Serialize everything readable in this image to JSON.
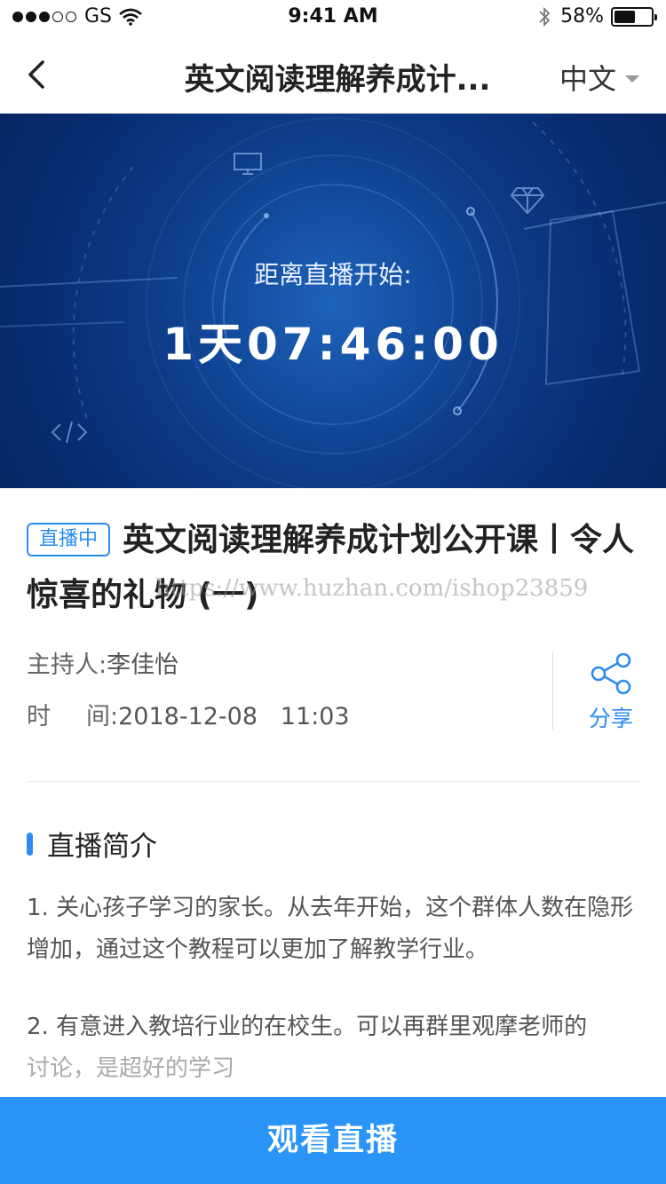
{
  "status_bar": {
    "carrier": "GS",
    "time": "9:41 AM",
    "battery_text": "58%",
    "battery_level": 0.58
  },
  "nav": {
    "title": "英文阅读理解养成计...",
    "language": "中文"
  },
  "hero": {
    "countdown_label": "距离直播开始:",
    "countdown_value": "1天07:46:00"
  },
  "course": {
    "badge": "直播中",
    "title": "英文阅读理解养成计划公开课丨令人惊喜的礼物 (一)",
    "watermark": "https://www.huzhan.com/ishop23859"
  },
  "meta": {
    "host_label": "主持人:",
    "host_name": "李佳怡",
    "time_label_1": "时",
    "time_label_2": "间:",
    "time_value": "2018-12-08   11:03"
  },
  "share": {
    "label": "分享"
  },
  "intro": {
    "heading": "直播简介",
    "paragraph_1": "1. 关心孩子学习的家长。从去年开始，这个群体人数在隐形增加，通过这个教程可以更加了解教学行业。",
    "paragraph_2_line_1": "2. 有意进入教培行业的在校生。可以再群里观摩老师的",
    "paragraph_2_line_2": "讨论，是超好的学习"
  },
  "cta": {
    "label": "观看直播"
  },
  "colors": {
    "accent": "#2a8cf1",
    "button": "#2a95f7",
    "hero_dark": "#05245e"
  },
  "icons": [
    "back-chevron-icon",
    "wifi-icon",
    "bluetooth-icon",
    "battery-icon",
    "share-icon",
    "monitor-icon",
    "diamond-icon",
    "code-icon"
  ]
}
